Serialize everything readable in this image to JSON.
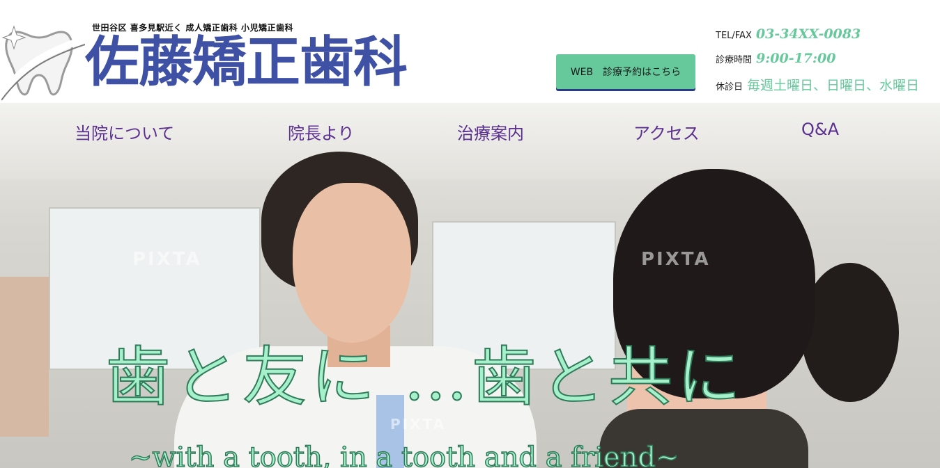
{
  "header": {
    "tagline": "世田谷区 喜多見駅近く 成人矯正歯科 小児矯正歯科",
    "clinic_name": "佐藤矯正歯科",
    "reserve_button": "WEB　診療予約はこちら",
    "tel_label": "TEL/FAX",
    "tel_value": "03-34XX-0083",
    "hours_label": "診療時間",
    "hours_value": "9:00-17:00",
    "closed_label": "休診日",
    "closed_value": "毎週土曜日、日曜日、水曜日"
  },
  "nav": {
    "items": [
      {
        "label": "当院について"
      },
      {
        "label": "院長より"
      },
      {
        "label": "治療案内"
      },
      {
        "label": "アクセス"
      },
      {
        "label": "Q&A"
      }
    ]
  },
  "hero": {
    "slogan": "歯と友に …歯と共に",
    "slogan_en": "~with a tooth, in a tooth and a friend~",
    "watermark": "PIXTA"
  },
  "colors": {
    "brand_blue": "#3f51a5",
    "accent_green": "#66c99c",
    "nav_purple": "#5a2f8e"
  }
}
